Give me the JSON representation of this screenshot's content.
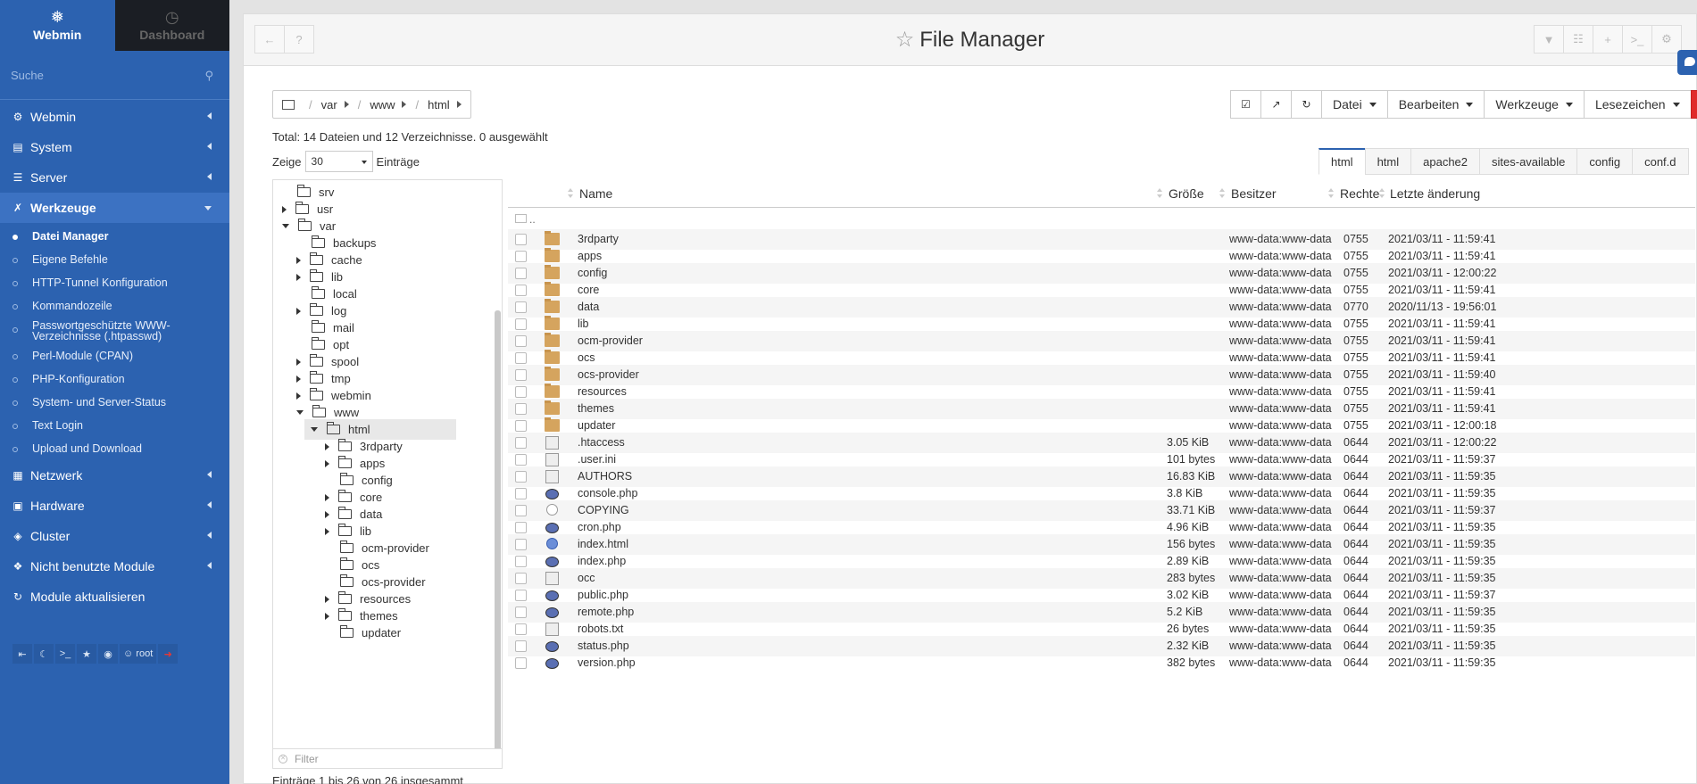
{
  "sidebar": {
    "tab_webmin": "Webmin",
    "tab_dashboard": "Dashboard",
    "search_placeholder": "Suche",
    "categories": {
      "webmin": "Webmin",
      "system": "System",
      "server": "Server",
      "werkzeuge": "Werkzeuge",
      "netzwerk": "Netzwerk",
      "hardware": "Hardware",
      "cluster": "Cluster",
      "unused": "Nicht benutzte Module",
      "refresh": "Module aktualisieren"
    },
    "tools": [
      "Datei Manager",
      "Eigene Befehle",
      "HTTP-Tunnel Konfiguration",
      "Kommandozeile",
      "Passwortgeschützte WWW-Verzeichnisse (.htpasswd)",
      "Perl-Module (CPAN)",
      "PHP-Konfiguration",
      "System- und Server-Status",
      "Text Login",
      "Upload und Download"
    ],
    "user": "root"
  },
  "panel": {
    "title": "File Manager",
    "breadcrumb": [
      "var",
      "www",
      "html"
    ],
    "toolbar": {
      "datei": "Datei",
      "bearbeiten": "Bearbeiten",
      "werkzeuge": "Werkzeuge",
      "lesezeichen": "Lesezeichen"
    },
    "summary": "Total: 14 Dateien und 12 Verzeichnisse. 0 ausgewählt",
    "show_label": "Zeige",
    "show_value": "30",
    "entries_label": "Einträge",
    "path_tabs": [
      "html",
      "html",
      "apache2",
      "sites-available",
      "config",
      "conf.d"
    ],
    "footer": "Einträge 1 bis 26 von 26 insgesammt",
    "filter_placeholder": "Filter"
  },
  "tree": {
    "nodes": [
      {
        "label": "srv",
        "level": 1,
        "toggle": "none"
      },
      {
        "label": "usr",
        "level": 1,
        "toggle": "right"
      },
      {
        "label": "var",
        "level": 1,
        "toggle": "down"
      },
      {
        "label": "backups",
        "level": 2,
        "toggle": "none"
      },
      {
        "label": "cache",
        "level": 2,
        "toggle": "right"
      },
      {
        "label": "lib",
        "level": 2,
        "toggle": "right"
      },
      {
        "label": "local",
        "level": 2,
        "toggle": "none"
      },
      {
        "label": "log",
        "level": 2,
        "toggle": "right"
      },
      {
        "label": "mail",
        "level": 2,
        "toggle": "none"
      },
      {
        "label": "opt",
        "level": 2,
        "toggle": "none"
      },
      {
        "label": "spool",
        "level": 2,
        "toggle": "right"
      },
      {
        "label": "tmp",
        "level": 2,
        "toggle": "right"
      },
      {
        "label": "webmin",
        "level": 2,
        "toggle": "right"
      },
      {
        "label": "www",
        "level": 2,
        "toggle": "down"
      },
      {
        "label": "html",
        "level": 3,
        "toggle": "down"
      },
      {
        "label": "3rdparty",
        "level": 4,
        "toggle": "right"
      },
      {
        "label": "apps",
        "level": 4,
        "toggle": "right"
      },
      {
        "label": "config",
        "level": 4,
        "toggle": "none"
      },
      {
        "label": "core",
        "level": 4,
        "toggle": "right"
      },
      {
        "label": "data",
        "level": 4,
        "toggle": "right"
      },
      {
        "label": "lib",
        "level": 4,
        "toggle": "right"
      },
      {
        "label": "ocm-provider",
        "level": 4,
        "toggle": "none"
      },
      {
        "label": "ocs",
        "level": 4,
        "toggle": "none"
      },
      {
        "label": "ocs-provider",
        "level": 4,
        "toggle": "none"
      },
      {
        "label": "resources",
        "level": 4,
        "toggle": "right"
      },
      {
        "label": "themes",
        "level": 4,
        "toggle": "right"
      },
      {
        "label": "updater",
        "level": 4,
        "toggle": "none"
      }
    ]
  },
  "table": {
    "headers": {
      "name": "Name",
      "size": "Größe",
      "owner": "Besitzer",
      "perms": "Rechte",
      "modified": "Letzte änderung"
    },
    "updir": "..",
    "rows": [
      {
        "name": "3rdparty",
        "size": "",
        "owner": "www-data:www-data",
        "perms": "0755",
        "date": "2021/03/11 - 11:59:41",
        "icon": "folder"
      },
      {
        "name": "apps",
        "size": "",
        "owner": "www-data:www-data",
        "perms": "0755",
        "date": "2021/03/11 - 11:59:41",
        "icon": "folder"
      },
      {
        "name": "config",
        "size": "",
        "owner": "www-data:www-data",
        "perms": "0755",
        "date": "2021/03/11 - 12:00:22",
        "icon": "folder"
      },
      {
        "name": "core",
        "size": "",
        "owner": "www-data:www-data",
        "perms": "0755",
        "date": "2021/03/11 - 11:59:41",
        "icon": "folder"
      },
      {
        "name": "data",
        "size": "",
        "owner": "www-data:www-data",
        "perms": "0770",
        "date": "2020/11/13 - 19:56:01",
        "icon": "folder"
      },
      {
        "name": "lib",
        "size": "",
        "owner": "www-data:www-data",
        "perms": "0755",
        "date": "2021/03/11 - 11:59:41",
        "icon": "folder"
      },
      {
        "name": "ocm-provider",
        "size": "",
        "owner": "www-data:www-data",
        "perms": "0755",
        "date": "2021/03/11 - 11:59:41",
        "icon": "folder"
      },
      {
        "name": "ocs",
        "size": "",
        "owner": "www-data:www-data",
        "perms": "0755",
        "date": "2021/03/11 - 11:59:41",
        "icon": "folder"
      },
      {
        "name": "ocs-provider",
        "size": "",
        "owner": "www-data:www-data",
        "perms": "0755",
        "date": "2021/03/11 - 11:59:40",
        "icon": "folder"
      },
      {
        "name": "resources",
        "size": "",
        "owner": "www-data:www-data",
        "perms": "0755",
        "date": "2021/03/11 - 11:59:41",
        "icon": "folder"
      },
      {
        "name": "themes",
        "size": "",
        "owner": "www-data:www-data",
        "perms": "0755",
        "date": "2021/03/11 - 11:59:41",
        "icon": "folder"
      },
      {
        "name": "updater",
        "size": "",
        "owner": "www-data:www-data",
        "perms": "0755",
        "date": "2021/03/11 - 12:00:18",
        "icon": "folder"
      },
      {
        "name": ".htaccess",
        "size": "3.05 KiB",
        "owner": "www-data:www-data",
        "perms": "0644",
        "date": "2021/03/11 - 12:00:22",
        "icon": "file"
      },
      {
        "name": ".user.ini",
        "size": "101 bytes",
        "owner": "www-data:www-data",
        "perms": "0644",
        "date": "2021/03/11 - 11:59:37",
        "icon": "file"
      },
      {
        "name": "AUTHORS",
        "size": "16.83 KiB",
        "owner": "www-data:www-data",
        "perms": "0644",
        "date": "2021/03/11 - 11:59:35",
        "icon": "person"
      },
      {
        "name": "console.php",
        "size": "3.8 KiB",
        "owner": "www-data:www-data",
        "perms": "0644",
        "date": "2021/03/11 - 11:59:35",
        "icon": "php"
      },
      {
        "name": "COPYING",
        "size": "33.71 KiB",
        "owner": "www-data:www-data",
        "perms": "0644",
        "date": "2021/03/11 - 11:59:37",
        "icon": "copy"
      },
      {
        "name": "cron.php",
        "size": "4.96 KiB",
        "owner": "www-data:www-data",
        "perms": "0644",
        "date": "2021/03/11 - 11:59:35",
        "icon": "php"
      },
      {
        "name": "index.html",
        "size": "156 bytes",
        "owner": "www-data:www-data",
        "perms": "0644",
        "date": "2021/03/11 - 11:59:35",
        "icon": "html"
      },
      {
        "name": "index.php",
        "size": "2.89 KiB",
        "owner": "www-data:www-data",
        "perms": "0644",
        "date": "2021/03/11 - 11:59:35",
        "icon": "php"
      },
      {
        "name": "occ",
        "size": "283 bytes",
        "owner": "www-data:www-data",
        "perms": "0644",
        "date": "2021/03/11 - 11:59:35",
        "icon": "file"
      },
      {
        "name": "public.php",
        "size": "3.02 KiB",
        "owner": "www-data:www-data",
        "perms": "0644",
        "date": "2021/03/11 - 11:59:37",
        "icon": "php"
      },
      {
        "name": "remote.php",
        "size": "5.2 KiB",
        "owner": "www-data:www-data",
        "perms": "0644",
        "date": "2021/03/11 - 11:59:35",
        "icon": "php"
      },
      {
        "name": "robots.txt",
        "size": "26 bytes",
        "owner": "www-data:www-data",
        "perms": "0644",
        "date": "2021/03/11 - 11:59:35",
        "icon": "file"
      },
      {
        "name": "status.php",
        "size": "2.32 KiB",
        "owner": "www-data:www-data",
        "perms": "0644",
        "date": "2021/03/11 - 11:59:35",
        "icon": "php"
      },
      {
        "name": "version.php",
        "size": "382 bytes",
        "owner": "www-data:www-data",
        "perms": "0644",
        "date": "2021/03/11 - 11:59:35",
        "icon": "php"
      }
    ]
  }
}
